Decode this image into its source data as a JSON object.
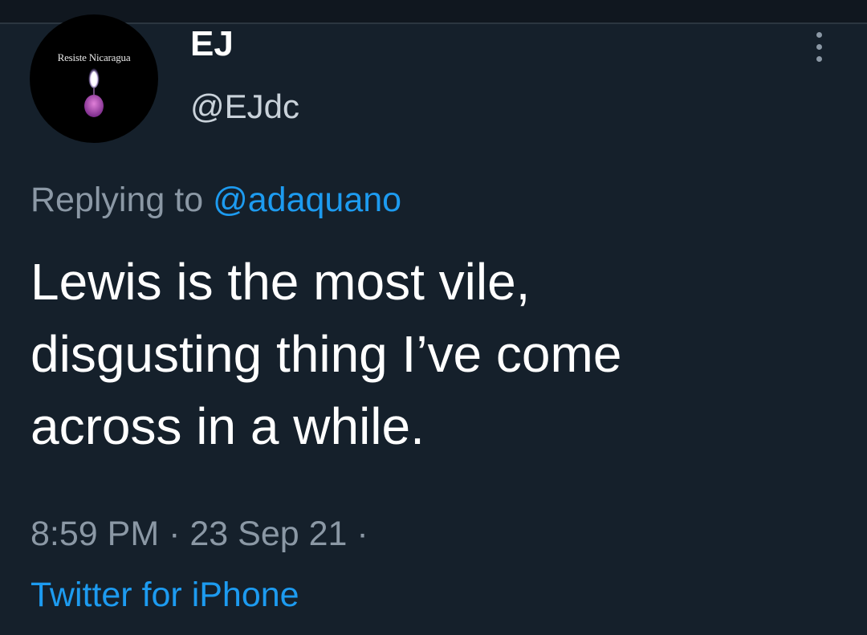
{
  "tweet": {
    "author": {
      "display_name": "EJ",
      "handle": "@EJdc",
      "avatar_text": "Resiste Nicaragua",
      "avatar_icon": "candle-icon"
    },
    "reply_context": {
      "prefix": "Replying to",
      "mention": "@adaquano"
    },
    "text_lines": [
      "Lewis is the most vile,",
      "disgusting thing I’ve come",
      "across in a while."
    ],
    "timestamp": {
      "time": "8:59 PM",
      "date": "23 Sep 21",
      "separator": "·"
    },
    "source": "Twitter for iPhone",
    "more_icon": "more-vertical-icon"
  },
  "colors": {
    "background": "#15202b",
    "text_primary": "#ffffff",
    "text_secondary": "#8b98a5",
    "accent": "#1d9bf0"
  }
}
